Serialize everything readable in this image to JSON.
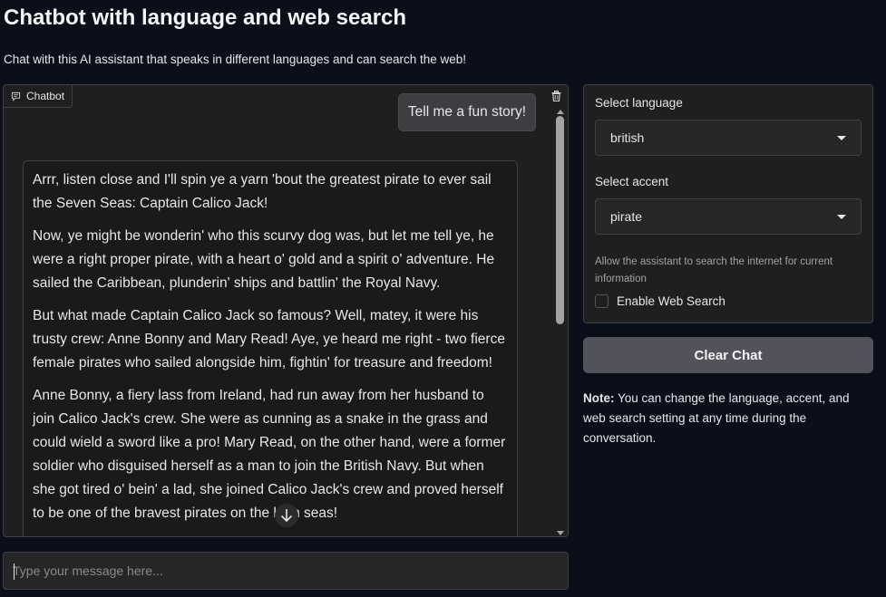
{
  "header": {
    "title": "Chatbot with language and web search",
    "subtitle": "Chat with this AI assistant that speaks in different languages and can search the web!"
  },
  "chatbot": {
    "label": "Chatbot",
    "messages": {
      "user": "Tell me a fun story!",
      "bot": [
        "Arrr, listen close and I'll spin ye a yarn 'bout the greatest pirate to ever sail the Seven Seas: Captain Calico Jack!",
        "Now, ye might be wonderin' who this scurvy dog was, but let me tell ye, he were a right proper pirate, with a heart o' gold and a spirit o' adventure. He sailed the Caribbean, plunderin' ships and battlin' the Royal Navy.",
        "But what made Captain Calico Jack so famous? Well, matey, it were his trusty crew: Anne Bonny and Mary Read! Aye, ye heard me right - two fierce female pirates who sailed alongside him, fightin' for treasure and freedom!",
        "Anne Bonny, a fiery lass from Ireland, had run away from her husband to join Calico Jack's crew. She were as cunning as a snake in the grass and could wield a sword like a pro! Mary Read, on the other hand, were a former soldier who disguised herself as a man to join the British Navy. But when she got tired o' bein' a lad, she joined Calico Jack's crew and proved herself to be one of the bravest pirates on the high seas!"
      ]
    }
  },
  "input": {
    "placeholder": "Type your message here...",
    "value": ""
  },
  "settings": {
    "language": {
      "label": "Select language",
      "value": "british"
    },
    "accent": {
      "label": "Select accent",
      "value": "pirate"
    },
    "web_search": {
      "info": "Allow the assistant to search the internet for current information",
      "label": "Enable Web Search",
      "checked": false
    }
  },
  "clear_button": "Clear Chat",
  "note": {
    "prefix": "Note:",
    "text": " You can change the language, accent, and web search setting at any time during the conversation."
  },
  "colors": {
    "background": "#0b0f19",
    "panel": "#1f1f1f",
    "button": "#52525b"
  }
}
